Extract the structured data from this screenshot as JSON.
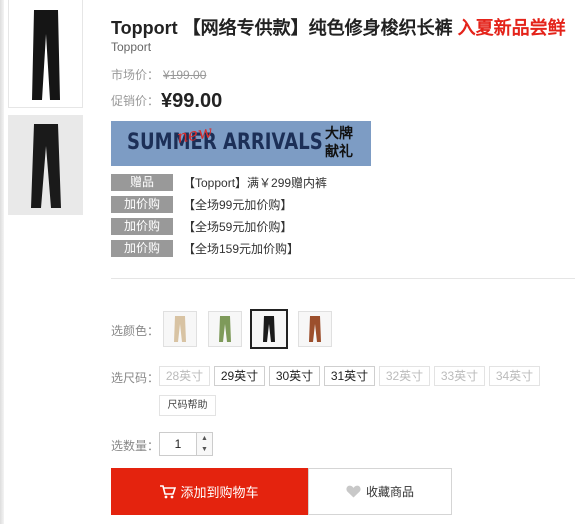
{
  "product": {
    "title": "Topport 【网络专供款】纯色修身梭织长裤",
    "title_promo": "入夏新品尝鲜",
    "brand": "Topport"
  },
  "price": {
    "market_label": "市场价：",
    "market_value": "¥199.00",
    "sale_label": "促销价：",
    "sale_value": "¥99.00"
  },
  "banner": {
    "text": "SUMMER ARRIVALS",
    "script_word": "new",
    "cn_text": "大牌献礼"
  },
  "promotions": [
    {
      "tag": "赠品",
      "text": "【Topport】满￥299赠内裤"
    },
    {
      "tag": "加价购",
      "text": "【全场99元加价购】"
    },
    {
      "tag": "加价购",
      "text": "【全场59元加价购】"
    },
    {
      "tag": "加价购",
      "text": "【全场159元加价购】"
    }
  ],
  "color": {
    "label": "选颜色：",
    "options": [
      {
        "name": "khaki",
        "hex": "#d8c3a3"
      },
      {
        "name": "green",
        "hex": "#7e9a5a"
      },
      {
        "name": "black",
        "hex": "#1b1b1b"
      },
      {
        "name": "brown",
        "hex": "#9c4f2c"
      }
    ],
    "selected_index": 2
  },
  "size": {
    "label": "选尺码：",
    "options": [
      {
        "label": "28英寸",
        "available": false
      },
      {
        "label": "29英寸",
        "available": true
      },
      {
        "label": "30英寸",
        "available": true
      },
      {
        "label": "31英寸",
        "available": true
      },
      {
        "label": "32英寸",
        "available": false
      },
      {
        "label": "33英寸",
        "available": false
      },
      {
        "label": "34英寸",
        "available": false
      }
    ],
    "help": "尺码帮助"
  },
  "quantity": {
    "label": "选数量：",
    "value": "1"
  },
  "actions": {
    "cart": "添加到购物车",
    "favorite": "收藏商品"
  },
  "colors": {
    "accent": "#e4230e",
    "promo_title": "#e4231a",
    "promo_tag_bg": "#999999",
    "banner_bg": "#7d9cc4"
  }
}
